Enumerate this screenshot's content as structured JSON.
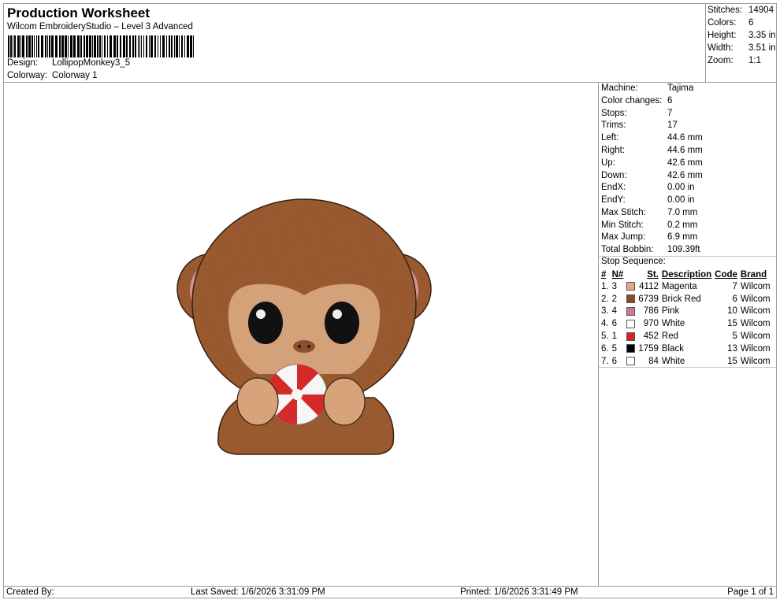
{
  "header": {
    "title": "Production Worksheet",
    "subtitle": "Wilcom EmbroideryStudio – Level 3 Advanced",
    "design_label": "Design:",
    "design_value": "LollipopMonkey3_5",
    "colorway_label": "Colorway:",
    "colorway_value": "Colorway 1"
  },
  "summary": {
    "rows": [
      {
        "label": "Stitches:",
        "value": "14904"
      },
      {
        "label": "Colors:",
        "value": "6"
      },
      {
        "label": "Height:",
        "value": "3.35 in"
      },
      {
        "label": "Width:",
        "value": "3.51 in"
      },
      {
        "label": "Zoom:",
        "value": "1:1"
      }
    ]
  },
  "properties": {
    "rows": [
      {
        "label": "Machine:",
        "value": "Tajima"
      },
      {
        "label": "Color changes:",
        "value": "6"
      },
      {
        "label": "Stops:",
        "value": "7"
      },
      {
        "label": "Trims:",
        "value": "17"
      },
      {
        "label": "Left:",
        "value": "44.6 mm"
      },
      {
        "label": "Right:",
        "value": "44.6 mm"
      },
      {
        "label": "Up:",
        "value": "42.6 mm"
      },
      {
        "label": "Down:",
        "value": "42.6 mm"
      },
      {
        "label": "EndX:",
        "value": "0.00 in"
      },
      {
        "label": "EndY:",
        "value": "0.00 in"
      },
      {
        "label": "Max Stitch:",
        "value": "7.0 mm"
      },
      {
        "label": "Min Stitch:",
        "value": "0.2 mm"
      },
      {
        "label": "Max Jump:",
        "value": "6.9 mm"
      },
      {
        "label": "Total Bobbin:",
        "value": "109.39ft"
      }
    ]
  },
  "stop_sequence": {
    "title": "Stop Sequence:",
    "headers": {
      "num": "#",
      "n": "N#",
      "st": "St.",
      "desc": "Description",
      "code": "Code",
      "brand": "Brand"
    },
    "rows": [
      {
        "num": "1.",
        "n": "3",
        "color": "#e8a48a",
        "st": "4112",
        "desc": "Magenta",
        "code": "7",
        "brand": "Wilcom"
      },
      {
        "num": "2.",
        "n": "2",
        "color": "#8a4a28",
        "st": "6739",
        "desc": "Brick Red",
        "code": "6",
        "brand": "Wilcom"
      },
      {
        "num": "3.",
        "n": "4",
        "color": "#d07890",
        "st": "786",
        "desc": "Pink",
        "code": "10",
        "brand": "Wilcom"
      },
      {
        "num": "4.",
        "n": "6",
        "color": "#ffffff",
        "st": "970",
        "desc": "White",
        "code": "15",
        "brand": "Wilcom"
      },
      {
        "num": "5.",
        "n": "1",
        "color": "#e02020",
        "st": "452",
        "desc": "Red",
        "code": "5",
        "brand": "Wilcom"
      },
      {
        "num": "6.",
        "n": "5",
        "color": "#000000",
        "st": "1759",
        "desc": "Black",
        "code": "13",
        "brand": "Wilcom"
      },
      {
        "num": "7.",
        "n": "6",
        "color": "#ffffff",
        "st": "84",
        "desc": "White",
        "code": "15",
        "brand": "Wilcom"
      }
    ]
  },
  "footer": {
    "created_by": "Created By:",
    "last_saved": "Last Saved: 1/6/2026 3:31:09 PM",
    "printed": "Printed: 1/6/2026 3:31:49 PM",
    "page": "Page 1 of 1"
  },
  "design_colors": {
    "fur": "#9a5a30",
    "face": "#d6a37a",
    "ear_inner": "#d89090",
    "eye": "#111111",
    "candy_red": "#d42a2a",
    "candy_white": "#f6f6f6"
  }
}
